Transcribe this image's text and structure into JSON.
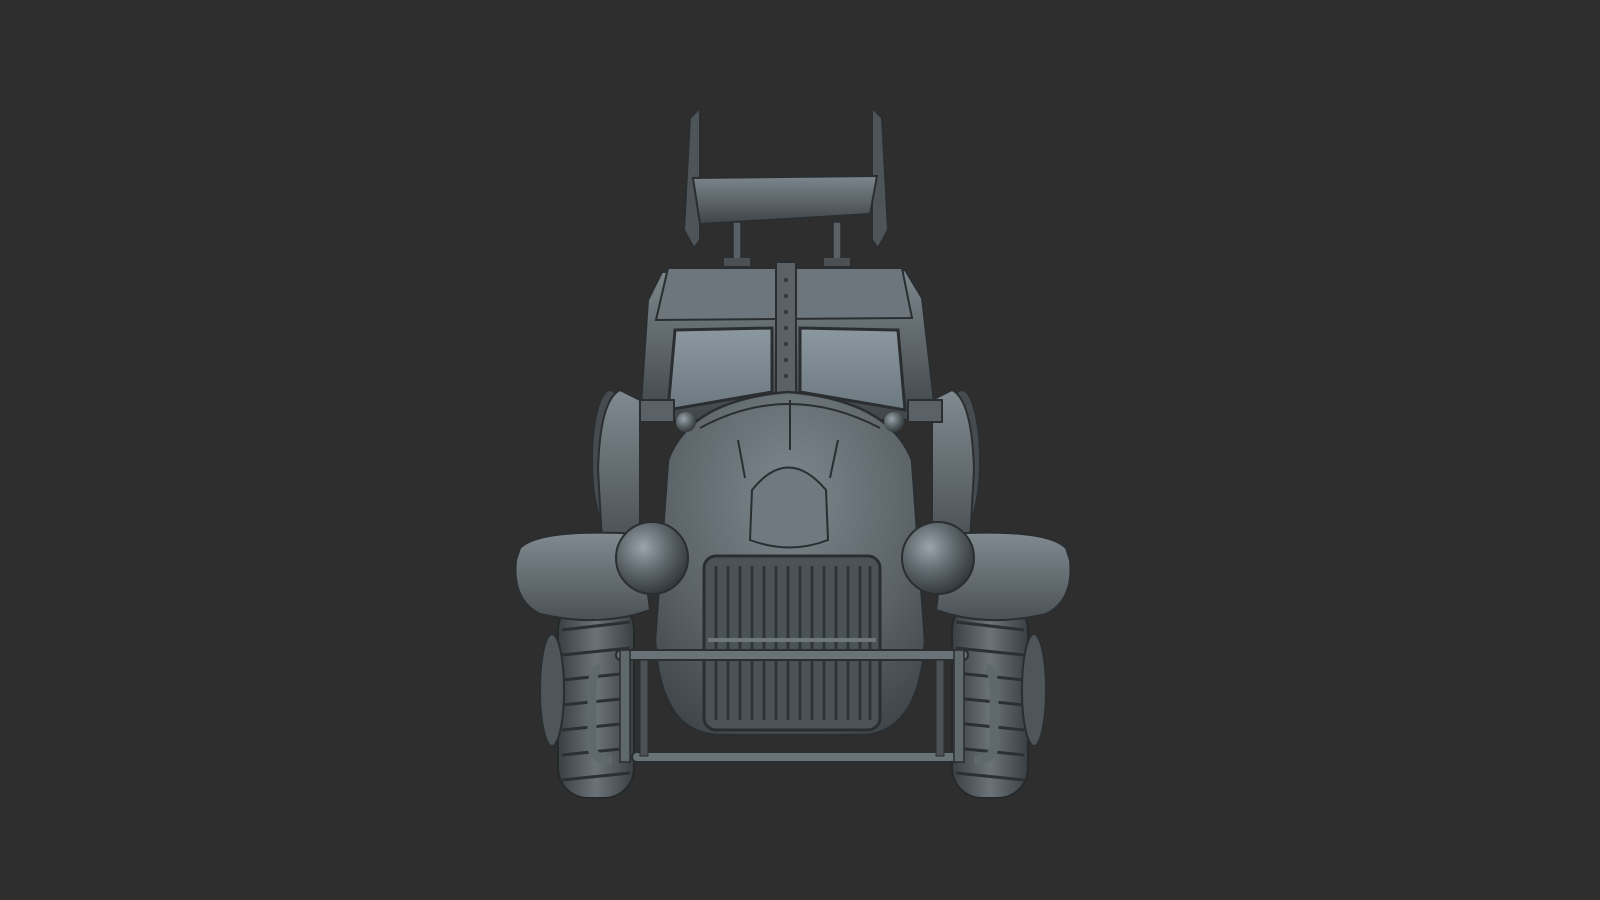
{
  "scene": {
    "subject": "sculpted-car-front-view",
    "background_color": "#2e2e2e",
    "material_color": "#5f676d",
    "material_highlight": "#8d979d",
    "material_shadow": "#34393c",
    "glass_color": "#7f8d96"
  }
}
